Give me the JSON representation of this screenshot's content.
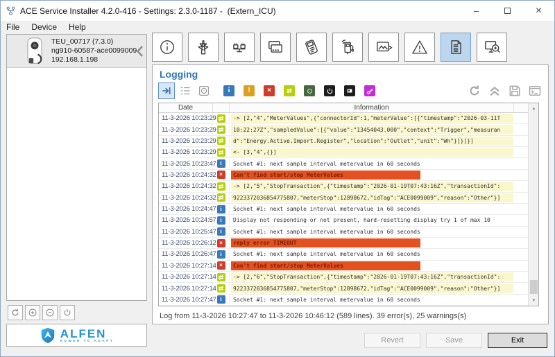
{
  "window": {
    "title": "ACE Service Installer 4.2.0-416 - Settings: 2.3.0-1187 -  (Extern_ICU)",
    "controls": {
      "minimize": "–",
      "close": "×"
    }
  },
  "menu": {
    "items": [
      "File",
      "Device",
      "Help"
    ]
  },
  "device": {
    "name": "TEU_00717 (7.3.0)",
    "serial": "ng910-60587-ace0099009",
    "ip": "192.168.1.198"
  },
  "toolbar": {
    "tabs": [
      {
        "icon": "device-info",
        "selected": false
      },
      {
        "icon": "grid-connection",
        "selected": false
      },
      {
        "icon": "load-balancing",
        "selected": false
      },
      {
        "icon": "authorization-cards",
        "selected": false
      },
      {
        "icon": "payment-terminal",
        "selected": false
      },
      {
        "icon": "charging-station",
        "selected": false
      },
      {
        "icon": "display-image",
        "selected": false
      },
      {
        "icon": "error-warning",
        "selected": false
      },
      {
        "icon": "logging",
        "selected": true
      },
      {
        "icon": "diagnostics",
        "selected": false
      }
    ],
    "selected_bg": "#bdd6ee"
  },
  "logging": {
    "title": "Logging",
    "filters": [
      {
        "icon": "follow-tail",
        "style": "selected"
      },
      {
        "icon": "list",
        "style": "plain"
      },
      {
        "icon": "record",
        "style": "plain"
      },
      {
        "icon": "info",
        "style": "square",
        "color": "#3878bc"
      },
      {
        "icon": "warning",
        "style": "square",
        "color": "#dd9f1d"
      },
      {
        "icon": "error",
        "style": "square",
        "color": "#d23b29"
      },
      {
        "icon": "message",
        "style": "square",
        "color": "#b5cf0a"
      },
      {
        "icon": "session",
        "style": "square",
        "color": "#46683f"
      },
      {
        "icon": "power",
        "style": "square",
        "color": "#1d1d1d"
      },
      {
        "icon": "terminal",
        "style": "square",
        "color": "#1d1d1d"
      },
      {
        "icon": "key",
        "style": "square",
        "color": "#c02fd4"
      }
    ],
    "actions": [
      "refresh",
      "collapse-all",
      "save-log",
      "console"
    ],
    "table": {
      "columns": {
        "date": "Date",
        "info": "Information"
      },
      "rows": [
        {
          "date": "11-3-2026 10:23:29",
          "type": "msg",
          "hl": "yellow",
          "text": "-> [2,\"4\",\"MeterValues\",{\"connectorId\":1,\"meterValue\":[{\"timestamp\":\"2026-03-11T"
        },
        {
          "date": "11-3-2026 10:23:29",
          "type": "msg",
          "hl": "yellow",
          "text": "10:22:27Z\",\"sampledValue\":[{\"value\":\"13454043.000\",\"context\":\"Trigger\",\"measuran"
        },
        {
          "date": "11-3-2026 10:23:29",
          "type": "msg",
          "hl": "yellow",
          "text": "d\":\"Energy.Active.Import.Register\",\"location\":\"Outlet\",\"unit\":\"Wh\"}]}]}]"
        },
        {
          "date": "11-3-2026 10:23:29",
          "type": "msg",
          "hl": "yellow",
          "text": "<- [3,\"4\",{}]"
        },
        {
          "date": "11-3-2026 10:23:47",
          "type": "info",
          "hl": "none",
          "text": "Socket #1: next sample interval metervalue in 60 seconds"
        },
        {
          "date": "11-3-2026 10:24:32",
          "type": "error",
          "hl": "red",
          "text": "Can't find start/stop MeterValues"
        },
        {
          "date": "11-3-2026 10:24:32",
          "type": "msg",
          "hl": "yellow",
          "text": "-> [2,\"5\",\"StopTransaction\",{\"timestamp\":\"2026-01-19T07:43:16Z\",\"transactionId\":"
        },
        {
          "date": "11-3-2026 10:24:32",
          "type": "msg",
          "hl": "yellow",
          "text": "9223372036854775807,\"meterStop\":12898672,\"idTag\":\"ACE0099009\",\"reason\":\"Other\"}]"
        },
        {
          "date": "11-3-2026 10:24:47",
          "type": "info",
          "hl": "none",
          "text": "Socket #1: next sample interval metervalue in 60 seconds"
        },
        {
          "date": "11-3-2026 10:24:57",
          "type": "info",
          "hl": "none",
          "text": "Display not responding or not present, hard-resetting display try 1 of max 10"
        },
        {
          "date": "11-3-2026 10:25:47",
          "type": "info",
          "hl": "none",
          "text": "Socket #1: next sample interval metervalue in 60 seconds"
        },
        {
          "date": "11-3-2026 10:26:12",
          "type": "error",
          "hl": "red",
          "text": "reply error TIMEOUT"
        },
        {
          "date": "11-3-2026 10:26:47",
          "type": "info",
          "hl": "none",
          "text": "Socket #1: next sample interval metervalue in 60 seconds"
        },
        {
          "date": "11-3-2026 10:27:14",
          "type": "error",
          "hl": "red",
          "text": "Can't find start/stop MeterValues"
        },
        {
          "date": "11-3-2026 10:27:14",
          "type": "msg",
          "hl": "yellow",
          "text": "-> [2,\"6\",\"StopTransaction\",{\"timestamp\":\"2026-01-19T07:43:16Z\",\"transactionId\":"
        },
        {
          "date": "11-3-2026 10:27:14",
          "type": "msg",
          "hl": "yellow",
          "text": "9223372036854775807,\"meterStop\":12898672,\"idTag\":\"ACE0099009\",\"reason\":\"Other\"}]"
        },
        {
          "date": "11-3-2026 10:27:47",
          "type": "info",
          "hl": "none",
          "text": "Socket #1: next sample interval metervalue in 60 seconds"
        }
      ]
    },
    "status": "Log from 11-3-2026 10:27:47 to 11-3-2026 10:46:12 (589 lines). 39 error(s), 25 warnings(s)",
    "log_icon_colors": {
      "info": "#3878bc",
      "msg": "#b5cf0a",
      "error": "#d23b29"
    },
    "highlight_colors": {
      "yellow": "#faf6cd",
      "red": "#e2511f"
    }
  },
  "footer": {
    "revert": "Revert",
    "save": "Save",
    "exit": "Exit"
  },
  "branding": {
    "name": "ALFEN",
    "tagline": "POWER TO ADAPT",
    "brand_color": "#2394d2"
  },
  "colors": {
    "accent_blue": "#2e74b5",
    "selected_filter_border": "#5c93c8"
  }
}
